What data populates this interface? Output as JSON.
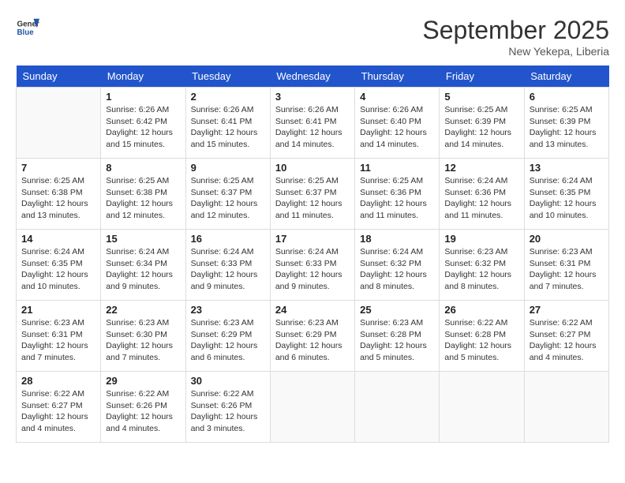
{
  "header": {
    "logo_line1": "General",
    "logo_line2": "Blue",
    "month": "September 2025",
    "location": "New Yekepa, Liberia"
  },
  "weekdays": [
    "Sunday",
    "Monday",
    "Tuesday",
    "Wednesday",
    "Thursday",
    "Friday",
    "Saturday"
  ],
  "weeks": [
    [
      {
        "day": "",
        "info": ""
      },
      {
        "day": "1",
        "info": "Sunrise: 6:26 AM\nSunset: 6:42 PM\nDaylight: 12 hours\nand 15 minutes."
      },
      {
        "day": "2",
        "info": "Sunrise: 6:26 AM\nSunset: 6:41 PM\nDaylight: 12 hours\nand 15 minutes."
      },
      {
        "day": "3",
        "info": "Sunrise: 6:26 AM\nSunset: 6:41 PM\nDaylight: 12 hours\nand 14 minutes."
      },
      {
        "day": "4",
        "info": "Sunrise: 6:26 AM\nSunset: 6:40 PM\nDaylight: 12 hours\nand 14 minutes."
      },
      {
        "day": "5",
        "info": "Sunrise: 6:25 AM\nSunset: 6:39 PM\nDaylight: 12 hours\nand 14 minutes."
      },
      {
        "day": "6",
        "info": "Sunrise: 6:25 AM\nSunset: 6:39 PM\nDaylight: 12 hours\nand 13 minutes."
      }
    ],
    [
      {
        "day": "7",
        "info": "Sunrise: 6:25 AM\nSunset: 6:38 PM\nDaylight: 12 hours\nand 13 minutes."
      },
      {
        "day": "8",
        "info": "Sunrise: 6:25 AM\nSunset: 6:38 PM\nDaylight: 12 hours\nand 12 minutes."
      },
      {
        "day": "9",
        "info": "Sunrise: 6:25 AM\nSunset: 6:37 PM\nDaylight: 12 hours\nand 12 minutes."
      },
      {
        "day": "10",
        "info": "Sunrise: 6:25 AM\nSunset: 6:37 PM\nDaylight: 12 hours\nand 11 minutes."
      },
      {
        "day": "11",
        "info": "Sunrise: 6:25 AM\nSunset: 6:36 PM\nDaylight: 12 hours\nand 11 minutes."
      },
      {
        "day": "12",
        "info": "Sunrise: 6:24 AM\nSunset: 6:36 PM\nDaylight: 12 hours\nand 11 minutes."
      },
      {
        "day": "13",
        "info": "Sunrise: 6:24 AM\nSunset: 6:35 PM\nDaylight: 12 hours\nand 10 minutes."
      }
    ],
    [
      {
        "day": "14",
        "info": "Sunrise: 6:24 AM\nSunset: 6:35 PM\nDaylight: 12 hours\nand 10 minutes."
      },
      {
        "day": "15",
        "info": "Sunrise: 6:24 AM\nSunset: 6:34 PM\nDaylight: 12 hours\nand 9 minutes."
      },
      {
        "day": "16",
        "info": "Sunrise: 6:24 AM\nSunset: 6:33 PM\nDaylight: 12 hours\nand 9 minutes."
      },
      {
        "day": "17",
        "info": "Sunrise: 6:24 AM\nSunset: 6:33 PM\nDaylight: 12 hours\nand 9 minutes."
      },
      {
        "day": "18",
        "info": "Sunrise: 6:24 AM\nSunset: 6:32 PM\nDaylight: 12 hours\nand 8 minutes."
      },
      {
        "day": "19",
        "info": "Sunrise: 6:23 AM\nSunset: 6:32 PM\nDaylight: 12 hours\nand 8 minutes."
      },
      {
        "day": "20",
        "info": "Sunrise: 6:23 AM\nSunset: 6:31 PM\nDaylight: 12 hours\nand 7 minutes."
      }
    ],
    [
      {
        "day": "21",
        "info": "Sunrise: 6:23 AM\nSunset: 6:31 PM\nDaylight: 12 hours\nand 7 minutes."
      },
      {
        "day": "22",
        "info": "Sunrise: 6:23 AM\nSunset: 6:30 PM\nDaylight: 12 hours\nand 7 minutes."
      },
      {
        "day": "23",
        "info": "Sunrise: 6:23 AM\nSunset: 6:29 PM\nDaylight: 12 hours\nand 6 minutes."
      },
      {
        "day": "24",
        "info": "Sunrise: 6:23 AM\nSunset: 6:29 PM\nDaylight: 12 hours\nand 6 minutes."
      },
      {
        "day": "25",
        "info": "Sunrise: 6:23 AM\nSunset: 6:28 PM\nDaylight: 12 hours\nand 5 minutes."
      },
      {
        "day": "26",
        "info": "Sunrise: 6:22 AM\nSunset: 6:28 PM\nDaylight: 12 hours\nand 5 minutes."
      },
      {
        "day": "27",
        "info": "Sunrise: 6:22 AM\nSunset: 6:27 PM\nDaylight: 12 hours\nand 4 minutes."
      }
    ],
    [
      {
        "day": "28",
        "info": "Sunrise: 6:22 AM\nSunset: 6:27 PM\nDaylight: 12 hours\nand 4 minutes."
      },
      {
        "day": "29",
        "info": "Sunrise: 6:22 AM\nSunset: 6:26 PM\nDaylight: 12 hours\nand 4 minutes."
      },
      {
        "day": "30",
        "info": "Sunrise: 6:22 AM\nSunset: 6:26 PM\nDaylight: 12 hours\nand 3 minutes."
      },
      {
        "day": "",
        "info": ""
      },
      {
        "day": "",
        "info": ""
      },
      {
        "day": "",
        "info": ""
      },
      {
        "day": "",
        "info": ""
      }
    ]
  ]
}
